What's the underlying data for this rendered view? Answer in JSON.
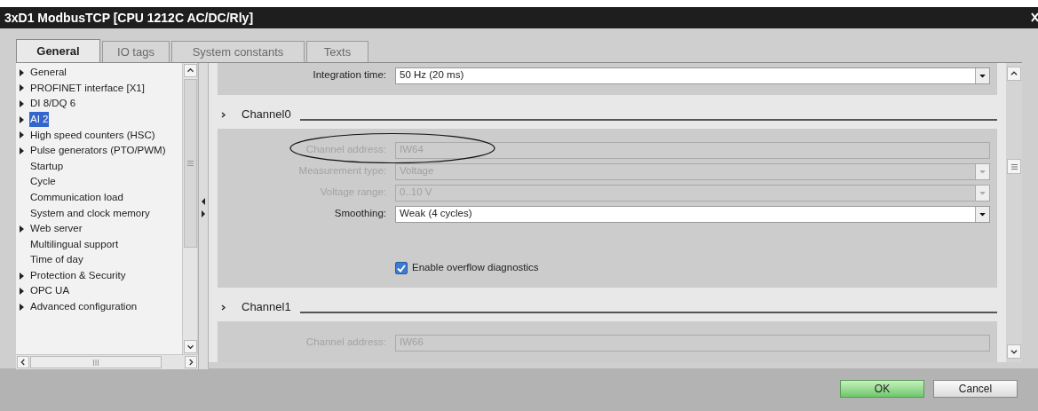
{
  "window": {
    "title": "3xD1 ModbusTCP [CPU 1212C AC/DC/Rly]"
  },
  "tabs": [
    {
      "label": "General",
      "selected": true
    },
    {
      "label": "IO tags",
      "selected": false
    },
    {
      "label": "System constants",
      "selected": false
    },
    {
      "label": "Texts",
      "selected": false
    }
  ],
  "nav": {
    "items": [
      {
        "label": "General",
        "expandable": true,
        "selected": false
      },
      {
        "label": "PROFINET interface [X1]",
        "expandable": true,
        "selected": false
      },
      {
        "label": "DI 8/DQ 6",
        "expandable": true,
        "selected": false
      },
      {
        "label": "AI 2",
        "expandable": true,
        "selected": true
      },
      {
        "label": "High speed counters (HSC)",
        "expandable": true,
        "selected": false
      },
      {
        "label": "Pulse generators (PTO/PWM)",
        "expandable": true,
        "selected": false
      },
      {
        "label": "Startup",
        "expandable": false,
        "selected": false
      },
      {
        "label": "Cycle",
        "expandable": false,
        "selected": false
      },
      {
        "label": "Communication load",
        "expandable": false,
        "selected": false
      },
      {
        "label": "System and clock memory",
        "expandable": false,
        "selected": false
      },
      {
        "label": "Web server",
        "expandable": true,
        "selected": false
      },
      {
        "label": "Multilingual support",
        "expandable": false,
        "selected": false
      },
      {
        "label": "Time of day",
        "expandable": false,
        "selected": false
      },
      {
        "label": "Protection & Security",
        "expandable": true,
        "selected": false
      },
      {
        "label": "OPC UA",
        "expandable": true,
        "selected": false
      },
      {
        "label": "Advanced configuration",
        "expandable": true,
        "selected": false
      }
    ]
  },
  "sections": [
    {
      "kind": "fields",
      "rows": [
        {
          "label": "Integration time:",
          "value": "50 Hz (20 ms)",
          "disabled": false,
          "dropdown": true
        }
      ]
    },
    {
      "kind": "channel",
      "title": "Channel0",
      "rows": [
        {
          "label": "Channel address:",
          "value": "IW64",
          "disabled": true,
          "dropdown": false,
          "circled": true
        },
        {
          "label": "Measurement type:",
          "value": "Voltage",
          "disabled": true,
          "dropdown": true
        },
        {
          "label": "Voltage range:",
          "value": "0..10 V",
          "disabled": true,
          "dropdown": true
        },
        {
          "label": "Smoothing:",
          "value": "Weak (4 cycles)",
          "disabled": false,
          "dropdown": true
        }
      ],
      "checkbox": {
        "label": "Enable overflow diagnostics",
        "checked": true
      }
    },
    {
      "kind": "channel",
      "title": "Channel1",
      "rows": [
        {
          "label": "Channel address:",
          "value": "IW66",
          "disabled": true,
          "dropdown": false
        }
      ]
    }
  ],
  "buttons": [
    {
      "label": "OK",
      "kind": "primary"
    },
    {
      "label": "Cancel",
      "kind": "secondary"
    }
  ]
}
